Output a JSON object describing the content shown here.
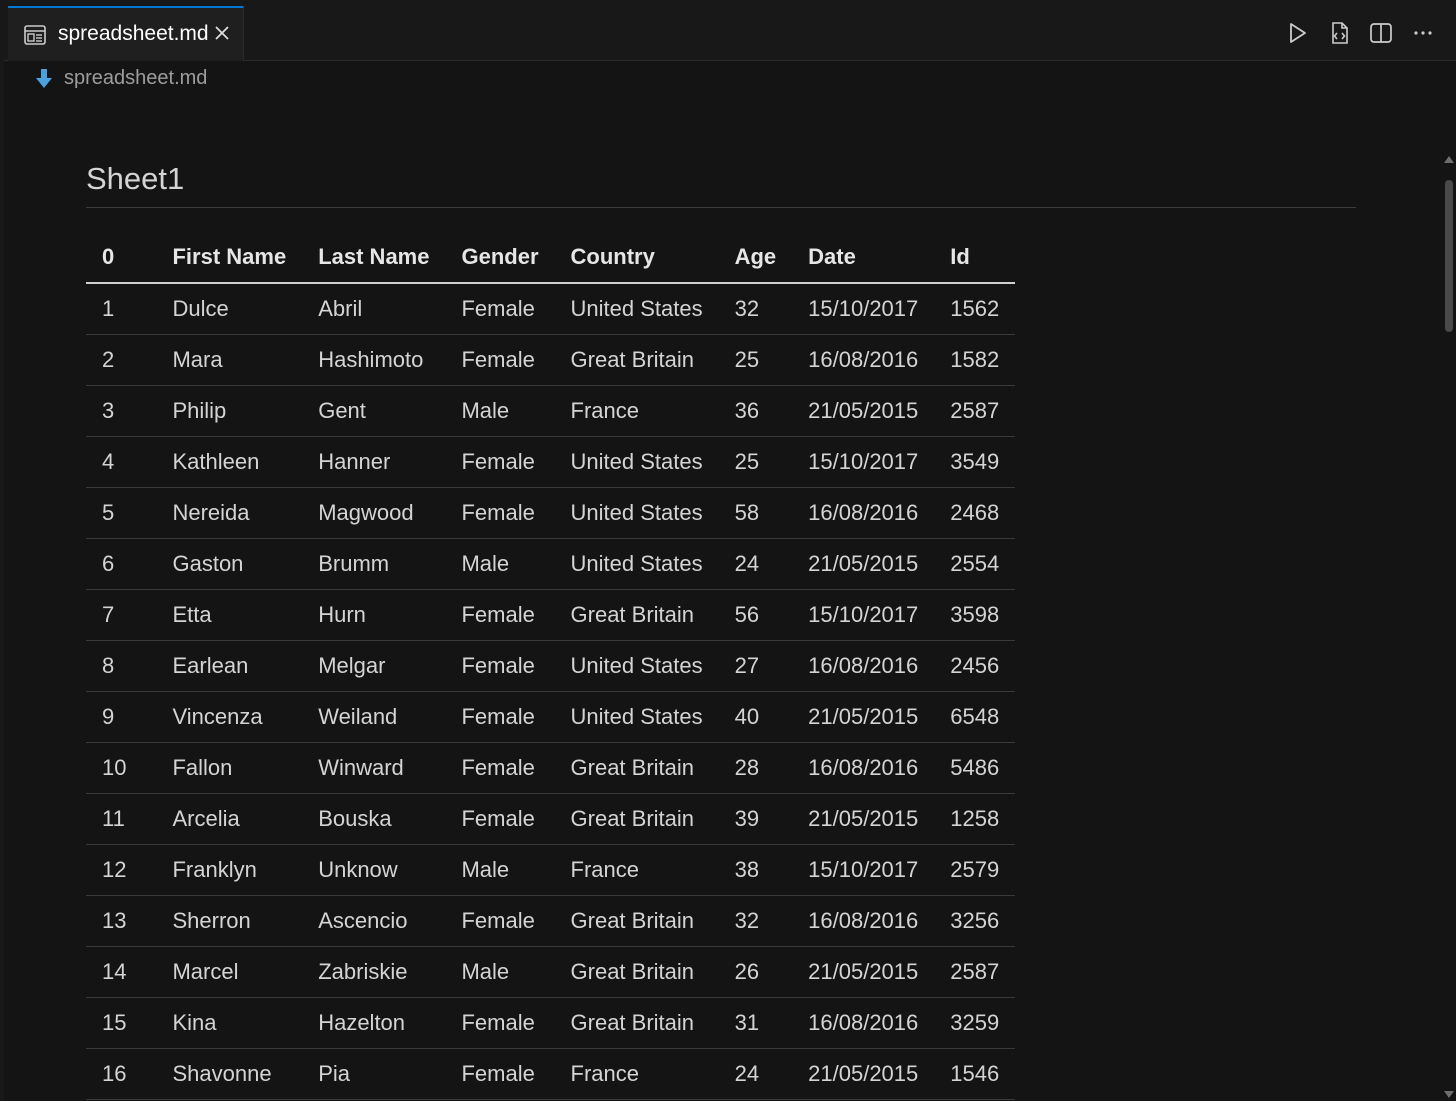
{
  "tab": {
    "label": "spreadsheet.md",
    "icon": "preview-icon"
  },
  "breadcrumb": {
    "label": "spreadsheet.md",
    "icon": "markdown-download-icon"
  },
  "actions": [
    "run-icon",
    "open-source-icon",
    "split-editor-icon",
    "more-actions-icon"
  ],
  "sheet": {
    "title": "Sheet1"
  },
  "table": {
    "headers": [
      "0",
      "First Name",
      "Last Name",
      "Gender",
      "Country",
      "Age",
      "Date",
      "Id"
    ],
    "rows": [
      [
        "1",
        "Dulce",
        "Abril",
        "Female",
        "United States",
        "32",
        "15/10/2017",
        "1562"
      ],
      [
        "2",
        "Mara",
        "Hashimoto",
        "Female",
        "Great Britain",
        "25",
        "16/08/2016",
        "1582"
      ],
      [
        "3",
        "Philip",
        "Gent",
        "Male",
        "France",
        "36",
        "21/05/2015",
        "2587"
      ],
      [
        "4",
        "Kathleen",
        "Hanner",
        "Female",
        "United States",
        "25",
        "15/10/2017",
        "3549"
      ],
      [
        "5",
        "Nereida",
        "Magwood",
        "Female",
        "United States",
        "58",
        "16/08/2016",
        "2468"
      ],
      [
        "6",
        "Gaston",
        "Brumm",
        "Male",
        "United States",
        "24",
        "21/05/2015",
        "2554"
      ],
      [
        "7",
        "Etta",
        "Hurn",
        "Female",
        "Great Britain",
        "56",
        "15/10/2017",
        "3598"
      ],
      [
        "8",
        "Earlean",
        "Melgar",
        "Female",
        "United States",
        "27",
        "16/08/2016",
        "2456"
      ],
      [
        "9",
        "Vincenza",
        "Weiland",
        "Female",
        "United States",
        "40",
        "21/05/2015",
        "6548"
      ],
      [
        "10",
        "Fallon",
        "Winward",
        "Female",
        "Great Britain",
        "28",
        "16/08/2016",
        "5486"
      ],
      [
        "11",
        "Arcelia",
        "Bouska",
        "Female",
        "Great Britain",
        "39",
        "21/05/2015",
        "1258"
      ],
      [
        "12",
        "Franklyn",
        "Unknow",
        "Male",
        "France",
        "38",
        "15/10/2017",
        "2579"
      ],
      [
        "13",
        "Sherron",
        "Ascencio",
        "Female",
        "Great Britain",
        "32",
        "16/08/2016",
        "3256"
      ],
      [
        "14",
        "Marcel",
        "Zabriskie",
        "Male",
        "Great Britain",
        "26",
        "21/05/2015",
        "2587"
      ],
      [
        "15",
        "Kina",
        "Hazelton",
        "Female",
        "Great Britain",
        "31",
        "16/08/2016",
        "3259"
      ],
      [
        "16",
        "Shavonne",
        "Pia",
        "Female",
        "France",
        "24",
        "21/05/2015",
        "1546"
      ]
    ]
  },
  "colors": {
    "accent": "#0078d4",
    "background": "#141414",
    "text": "#d4d4d4"
  }
}
